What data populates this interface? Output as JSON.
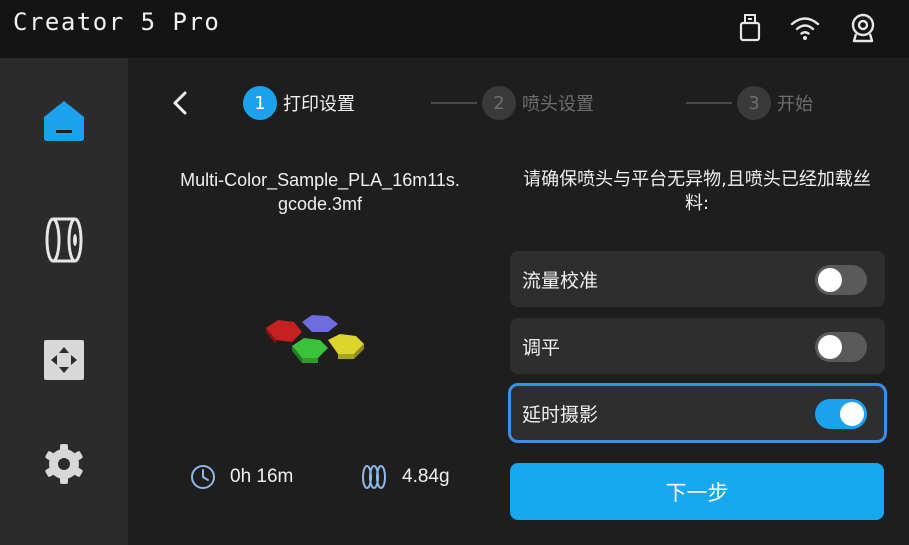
{
  "app": {
    "title": "Creator 5 Pro"
  },
  "status_icons": [
    "usb-icon",
    "wifi-icon",
    "camera-icon"
  ],
  "sidebar": {
    "items": [
      {
        "name": "home",
        "icon": "home-icon",
        "active": true
      },
      {
        "name": "filament",
        "icon": "filament-spool-icon",
        "active": false
      },
      {
        "name": "move",
        "icon": "move-axis-icon",
        "active": false
      },
      {
        "name": "settings",
        "icon": "gear-icon",
        "active": false
      }
    ]
  },
  "steps": [
    {
      "number": "1",
      "label": "打印设置",
      "active": true
    },
    {
      "number": "2",
      "label": "喷头设置",
      "active": false
    },
    {
      "number": "3",
      "label": "开始",
      "active": false
    }
  ],
  "file": {
    "name": "Multi-Color_Sample_PLA_16m11s.\ngcode.3mf"
  },
  "stats": {
    "time": "0h 16m",
    "weight": "4.84g"
  },
  "instruction": "请确保喷头与平台无异物,且喷头已经加载丝\n料:",
  "options": [
    {
      "label": "流量校准",
      "enabled": false,
      "selected": false
    },
    {
      "label": "调平",
      "enabled": false,
      "selected": false
    },
    {
      "label": "延时摄影",
      "enabled": true,
      "selected": true
    }
  ],
  "next_button": "下一步",
  "colors": {
    "accent": "#1aa3ec",
    "selection_outline": "#3a8ee8",
    "sidebar_bg": "#2b2b2b",
    "topbar_bg": "#141414"
  }
}
